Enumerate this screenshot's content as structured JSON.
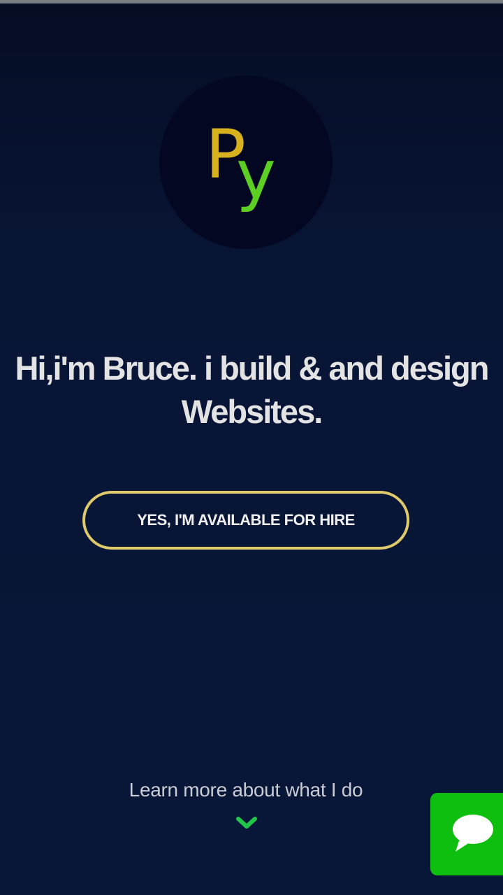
{
  "logo": {
    "letter_p": "P",
    "letter_y": "y",
    "colors": {
      "p": "#d8b21e",
      "y": "#5ccf22",
      "circle": "#030722"
    }
  },
  "hero": {
    "headline_line1": "Hi,i'm Bruce. i build & and design",
    "headline_line2": "Websites."
  },
  "hire_button": {
    "label": "YES, I'M AVAILABLE FOR HIRE",
    "border_color": "#dfca6c"
  },
  "learn_more": {
    "label": "Learn more about what I do",
    "icon": "chevron-down-icon",
    "icon_color": "#1fc64a"
  },
  "chat": {
    "icon": "chat-bubble-icon",
    "color": "#0fbf0f"
  },
  "theme": {
    "background": "#081638",
    "text": "#e3e3e3"
  }
}
